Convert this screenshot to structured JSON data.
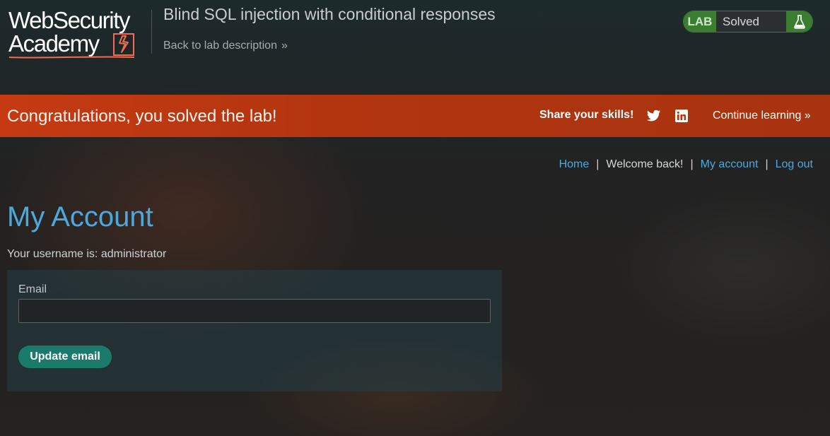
{
  "header": {
    "logo_line1": "WebSecurity",
    "logo_line2": "Academy",
    "lab_title": "Blind SQL injection with conditional responses",
    "back_link": "Back to lab description",
    "back_chevron": "»",
    "lab_status": {
      "tag": "LAB",
      "state": "Solved",
      "icon": "flask-icon"
    }
  },
  "banner": {
    "message": "Congratulations, you solved the lab!",
    "share_label": "Share your skills!",
    "social_icons": [
      "twitter-icon",
      "linkedin-icon"
    ],
    "continue_label": "Continue learning",
    "continue_chevron": "»"
  },
  "nav": {
    "home": "Home",
    "welcome": "Welcome back!",
    "my_account": "My account",
    "log_out": "Log out",
    "separator": "|"
  },
  "main": {
    "title": "My Account",
    "username_text": "Your username is: administrator",
    "email_label": "Email",
    "email_value": "",
    "update_button": "Update email"
  },
  "colors": {
    "accent_blue": "#4ba9e0",
    "banner_orange": "#c53a12",
    "lab_green": "#3b7e31",
    "button_teal": "#1b7b6b"
  }
}
